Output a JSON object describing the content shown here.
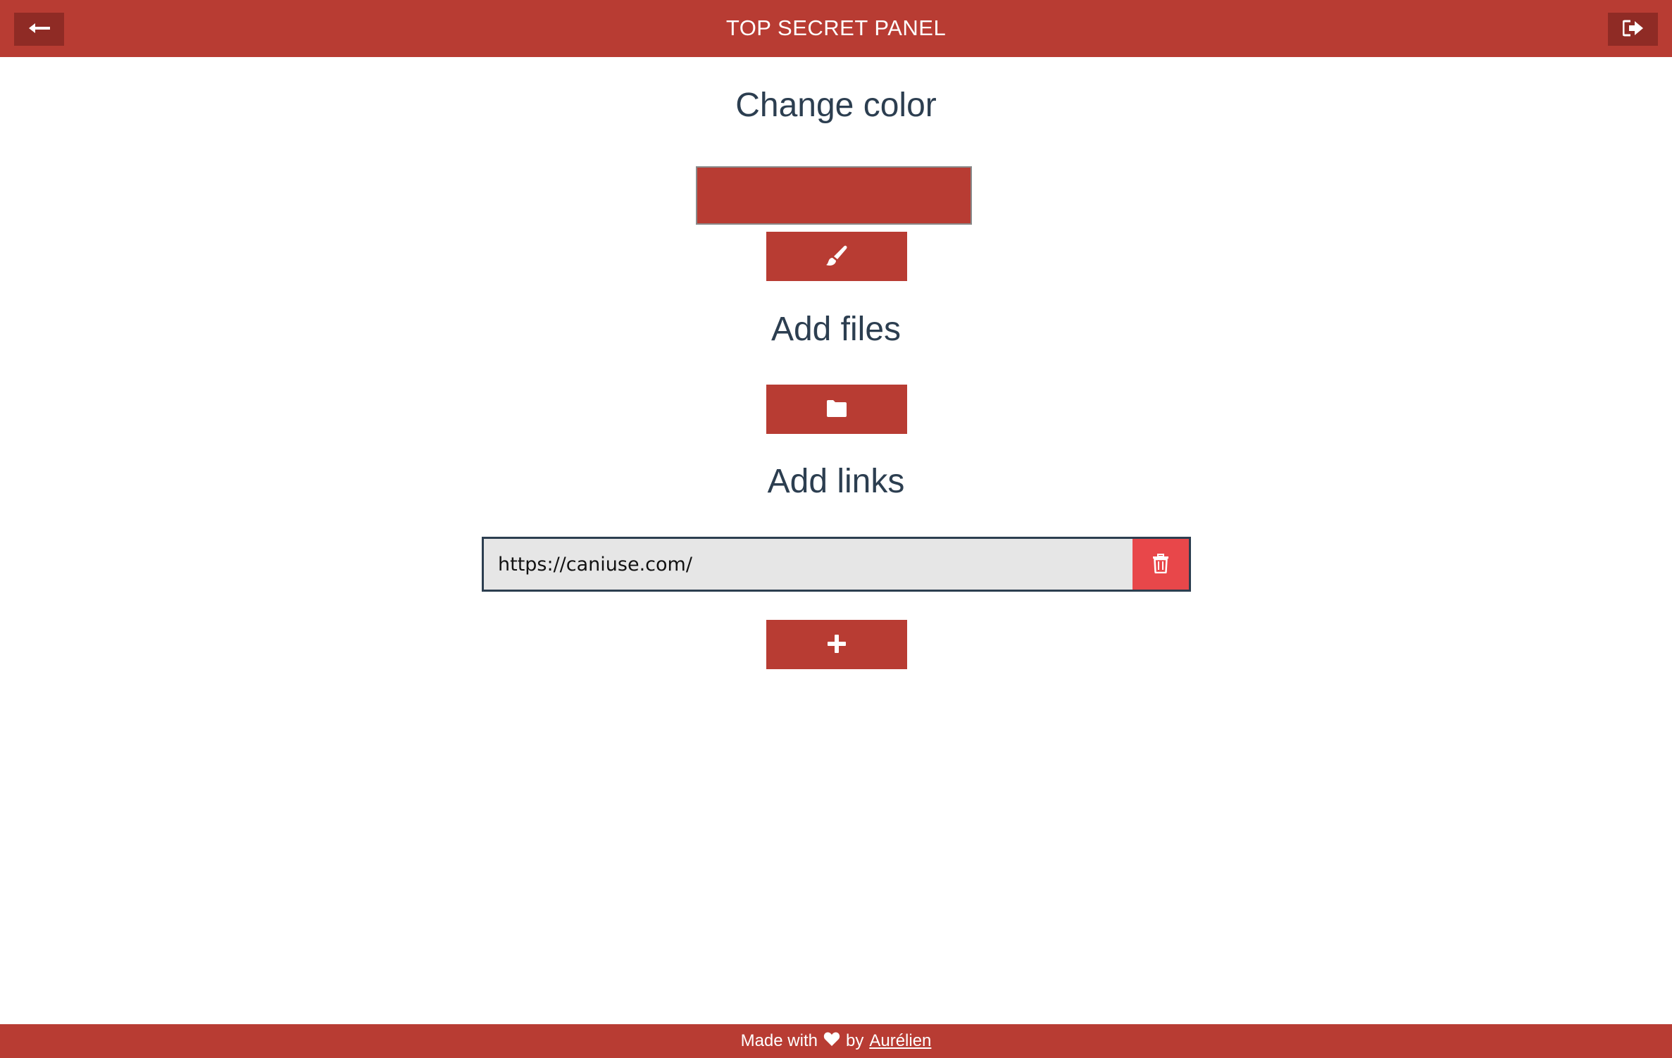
{
  "header": {
    "title": "TOP SECRET PANEL",
    "back_icon": "arrow-left-icon",
    "logout_icon": "sign-out-icon"
  },
  "sections": {
    "change_color": {
      "title": "Change color",
      "swatch_color": "#b83c33",
      "button_icon": "paint-brush-icon"
    },
    "add_files": {
      "title": "Add files",
      "button_icon": "folder-icon"
    },
    "add_links": {
      "title": "Add links",
      "links": [
        {
          "value": "https://caniuse.com/",
          "delete_icon": "trash-icon"
        }
      ],
      "add_icon": "plus-icon"
    }
  },
  "footer": {
    "prefix": "Made with",
    "heart_icon": "heart-icon",
    "by": "by",
    "author": "Aurélien"
  },
  "colors": {
    "brand": "#b83c33",
    "brand_dark": "#8f2b25",
    "danger": "#e8474a",
    "text": "#2c3e50",
    "input_bg": "#e6e6e6"
  }
}
